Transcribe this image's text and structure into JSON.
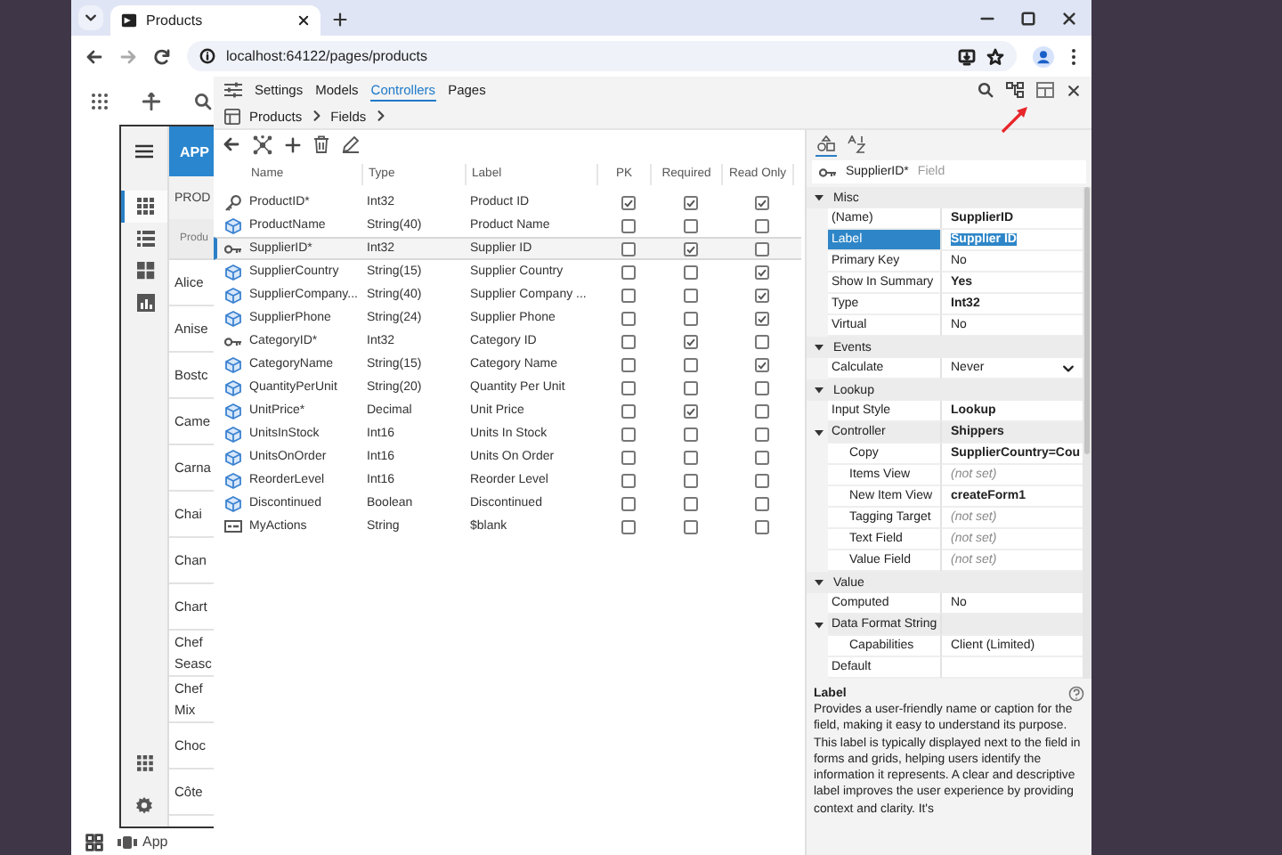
{
  "browser": {
    "tab_title": "Products",
    "url": "localhost:64122/pages/products"
  },
  "app": {
    "header": "APP",
    "title": "PROD",
    "column_header": "Produ",
    "nav": [
      {
        "kind": "grid",
        "selected": true
      },
      {
        "kind": "list",
        "selected": false
      },
      {
        "kind": "tiles",
        "selected": false
      },
      {
        "kind": "chart",
        "selected": false
      }
    ],
    "rows": [
      "Alice",
      "Anise",
      "Bostc",
      "Came",
      "Carna",
      "Chai",
      "Chan",
      "Chart",
      "Chef Seasc",
      "Chef Mix",
      "Choc",
      "Côte"
    ],
    "taskbar_label": "App"
  },
  "designer": {
    "tabs": [
      {
        "label": "Settings",
        "selected": false
      },
      {
        "label": "Models",
        "selected": false
      },
      {
        "label": "Controllers",
        "selected": true
      },
      {
        "label": "Pages",
        "selected": false
      }
    ],
    "breadcrumb": [
      "Products",
      "Fields"
    ],
    "fields_table": {
      "columns": [
        "Name",
        "Type",
        "Label",
        "PK",
        "Required",
        "Read Only"
      ],
      "rows": [
        {
          "kind": "primary-key",
          "name": "ProductID*",
          "type": "Int32",
          "label": "Product ID",
          "pk": true,
          "required": true,
          "read_only": true,
          "selected": false
        },
        {
          "kind": "field",
          "name": "ProductName",
          "type": "String(40)",
          "label": "Product Name",
          "pk": false,
          "required": false,
          "read_only": false,
          "selected": false
        },
        {
          "kind": "foreign-key",
          "name": "SupplierID*",
          "type": "Int32",
          "label": "Supplier ID",
          "pk": false,
          "required": true,
          "read_only": false,
          "selected": true
        },
        {
          "kind": "field",
          "name": "SupplierCountry",
          "type": "String(15)",
          "label": "Supplier Country",
          "pk": false,
          "required": false,
          "read_only": true,
          "selected": false
        },
        {
          "kind": "field",
          "name": "SupplierCompany...",
          "type": "String(40)",
          "label": "Supplier Company ...",
          "pk": false,
          "required": false,
          "read_only": true,
          "selected": false
        },
        {
          "kind": "field",
          "name": "SupplierPhone",
          "type": "String(24)",
          "label": "Supplier Phone",
          "pk": false,
          "required": false,
          "read_only": true,
          "selected": false
        },
        {
          "kind": "foreign-key",
          "name": "CategoryID*",
          "type": "Int32",
          "label": "Category ID",
          "pk": false,
          "required": true,
          "read_only": false,
          "selected": false
        },
        {
          "kind": "field",
          "name": "CategoryName",
          "type": "String(15)",
          "label": "Category Name",
          "pk": false,
          "required": false,
          "read_only": true,
          "selected": false
        },
        {
          "kind": "field",
          "name": "QuantityPerUnit",
          "type": "String(20)",
          "label": "Quantity Per Unit",
          "pk": false,
          "required": false,
          "read_only": false,
          "selected": false
        },
        {
          "kind": "field",
          "name": "UnitPrice*",
          "type": "Decimal",
          "label": "Unit Price",
          "pk": false,
          "required": true,
          "read_only": false,
          "selected": false
        },
        {
          "kind": "field",
          "name": "UnitsInStock",
          "type": "Int16",
          "label": "Units In Stock",
          "pk": false,
          "required": false,
          "read_only": false,
          "selected": false
        },
        {
          "kind": "field",
          "name": "UnitsOnOrder",
          "type": "Int16",
          "label": "Units On Order",
          "pk": false,
          "required": false,
          "read_only": false,
          "selected": false
        },
        {
          "kind": "field",
          "name": "ReorderLevel",
          "type": "Int16",
          "label": "Reorder Level",
          "pk": false,
          "required": false,
          "read_only": false,
          "selected": false
        },
        {
          "kind": "field",
          "name": "Discontinued",
          "type": "Boolean",
          "label": "Discontinued",
          "pk": false,
          "required": false,
          "read_only": false,
          "selected": false
        },
        {
          "kind": "actions",
          "name": "MyActions",
          "type": "String",
          "label": "$blank",
          "pk": false,
          "required": false,
          "read_only": false,
          "selected": false
        }
      ]
    },
    "properties": {
      "sort_modes": [
        {
          "kind": "categorized",
          "selected": true
        },
        {
          "kind": "alphabetical",
          "selected": false
        }
      ],
      "object_name": "SupplierID*",
      "object_type": "Field",
      "categories": [
        {
          "name": "Misc",
          "expanded": true,
          "properties": [
            {
              "label": "(Name)",
              "kind": "text",
              "value": "SupplierID",
              "modified": true,
              "selected": false
            },
            {
              "label": "Label",
              "kind": "text",
              "value": "Supplier ID",
              "modified": true,
              "selected": true
            },
            {
              "label": "Primary Key",
              "kind": "text",
              "value": "No",
              "modified": false,
              "selected": false
            },
            {
              "label": "Show In Summary",
              "kind": "text",
              "value": "Yes",
              "modified": true,
              "selected": false
            },
            {
              "label": "Type",
              "kind": "text",
              "value": "Int32",
              "modified": true,
              "selected": false
            },
            {
              "label": "Virtual",
              "kind": "text",
              "value": "No",
              "modified": false,
              "selected": false
            }
          ]
        },
        {
          "name": "Events",
          "expanded": true,
          "properties": [
            {
              "label": "Calculate",
              "kind": "dropdown",
              "value": "Never",
              "modified": false,
              "selected": false
            }
          ]
        },
        {
          "name": "Lookup",
          "expanded": true,
          "properties": [
            {
              "label": "Input Style",
              "kind": "text",
              "value": "Lookup",
              "modified": true,
              "selected": false
            },
            {
              "label": "Controller",
              "kind": "text",
              "value": "Shippers",
              "modified": true,
              "selected": false,
              "expanded": true,
              "children": [
                {
                  "label": "Copy",
                  "kind": "text",
                  "value": "SupplierCountry=Cou",
                  "modified": true,
                  "selected": false
                },
                {
                  "label": "Items View",
                  "kind": "unset",
                  "value": "(not set)",
                  "modified": false,
                  "selected": false
                },
                {
                  "label": "New Item View",
                  "kind": "text",
                  "value": "createForm1",
                  "modified": true,
                  "selected": false
                },
                {
                  "label": "Tagging Target",
                  "kind": "unset",
                  "value": "(not set)",
                  "modified": false,
                  "selected": false
                },
                {
                  "label": "Text Field",
                  "kind": "unset",
                  "value": "(not set)",
                  "modified": false,
                  "selected": false
                },
                {
                  "label": "Value Field",
                  "kind": "unset",
                  "value": "(not set)",
                  "modified": false,
                  "selected": false
                }
              ]
            }
          ]
        },
        {
          "name": "Value",
          "expanded": true,
          "properties": [
            {
              "label": "Computed",
              "kind": "text",
              "value": "No",
              "modified": false,
              "selected": false
            },
            {
              "label": "Data Format String",
              "kind": "text",
              "modified": false,
              "selected": false,
              "expanded": true,
              "children": [
                {
                  "label": "Capabilities",
                  "kind": "text",
                  "value": "Client (Limited)",
                  "modified": false,
                  "selected": false
                }
              ]
            },
            {
              "label": "Default",
              "kind": "text",
              "modified": false,
              "selected": false
            }
          ]
        }
      ],
      "description": {
        "title": "Label",
        "text": "Provides a user-friendly name or caption for the field, making it easy to understand its purpose. This label is typically displayed next to the field in forms and grids, helping users identify the information it represents. A clear and descriptive label improves the user experience by providing context and clarity. It's"
      }
    }
  }
}
